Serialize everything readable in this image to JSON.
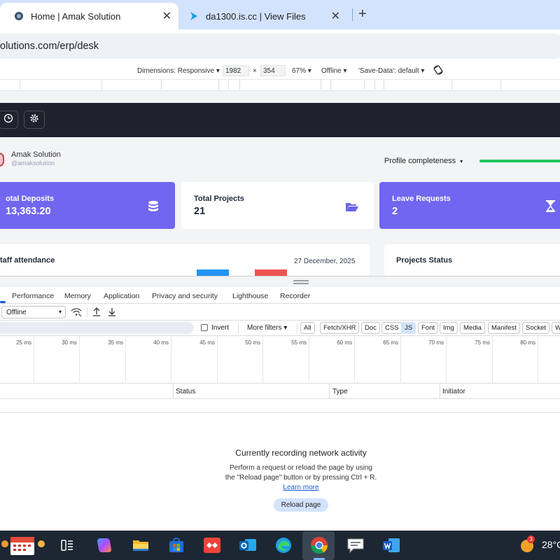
{
  "browser": {
    "tabs": [
      {
        "title": "Home | Amak Solution",
        "active": true,
        "icon": "globe-icon"
      },
      {
        "title": "da1300.is.cc | View Files",
        "active": false,
        "icon": "arrow-logo-icon"
      }
    ],
    "new_tab_label": "+",
    "close_label": "✕",
    "url": "olutions.com/erp/desk"
  },
  "device_toolbar": {
    "dimensions": "Dimensions: Responsive ▾",
    "width": "1982",
    "times": "×",
    "height": "354",
    "zoom": "67% ▾",
    "network": "Offline ▾",
    "save_data": "'Save-Data': default ▾"
  },
  "app": {
    "company_name": "Amak Solution",
    "company_handle": "@amaksolution",
    "profile_completeness_label": "Profile completeness",
    "profile_completeness_caret": "▾",
    "cards": [
      {
        "label": "otal Deposits",
        "value": "13,363.20",
        "icon": "database-icon"
      },
      {
        "label": "Total Projects",
        "value": "21",
        "icon": "folder-open-icon"
      },
      {
        "label": "Leave Requests",
        "value": "2",
        "icon": "hourglass-icon"
      }
    ],
    "attendance_title": "taff attendance",
    "attendance_date": "27 December, 2025",
    "projects_status_title": "Projects Status",
    "colors": {
      "accent": "#7166ef",
      "progress": "#22c55e",
      "bar_blue": "#2196f3",
      "bar_red": "#ef5350",
      "nav": "#1e222d"
    }
  },
  "devtools": {
    "tabs": [
      "Performance",
      "Memory",
      "Application",
      "Privacy and security",
      "Lighthouse",
      "Recorder"
    ],
    "throttle": "Offline",
    "throttle_caret": "▾",
    "invert_label": "Invert",
    "more_filters": "More filters ▾",
    "filters": [
      "All",
      "Fetch/XHR",
      "Doc",
      "CSS",
      "JS",
      "Font",
      "Img",
      "Media",
      "Manifest",
      "Socket",
      "W"
    ],
    "timeline_labels": [
      "25 ms",
      "30 ms",
      "35 ms",
      "40 ms",
      "45 ms",
      "50 ms",
      "55 ms",
      "60 ms",
      "65 ms",
      "70 ms",
      "75 ms",
      "80 ms"
    ],
    "columns": [
      "Status",
      "Type",
      "Initiator"
    ],
    "empty_title": "Currently recording network activity",
    "empty_text": "Perform a request or reload the page by using the \"Reload page\" button or by pressing Ctrl + R.",
    "learn_more": "Learn more",
    "reload_button": "Reload page"
  },
  "taskbar": {
    "temperature": "28°C",
    "weather_badge": "3",
    "apps": [
      "calendar-widget-icon",
      "task-view-icon",
      "copilot-icon",
      "file-explorer-icon",
      "microsoft-store-icon",
      "anydesk-icon",
      "outlook-icon",
      "edge-icon",
      "chrome-icon",
      "feedback-icon",
      "word-icon"
    ]
  }
}
